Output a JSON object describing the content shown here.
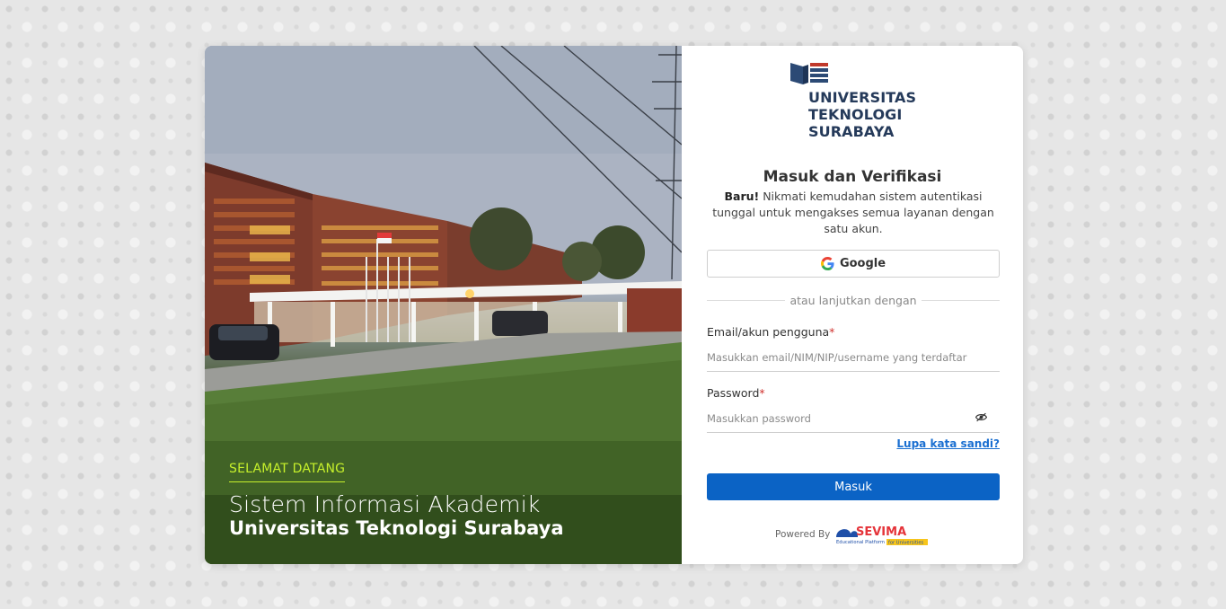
{
  "hero": {
    "welcome": "SELAMAT DATANG",
    "title": "Sistem Informasi Akademik",
    "subtitle": "Universitas Teknologi Surabaya"
  },
  "brand": {
    "line1": "UNIVERSITAS",
    "line2": "TEKNOLOGI",
    "line3": "SURABAYA",
    "color": "#253a5a"
  },
  "login": {
    "heading": "Masuk dan Verifikasi",
    "desc_bold": "Baru!",
    "desc_text": " Nikmati kemudahan sistem autentikasi tunggal untuk mengakses semua layanan dengan satu akun.",
    "google_label": "Google",
    "divider_text": "atau lanjutkan dengan",
    "email_label": "Email/akun pengguna",
    "email_placeholder": "Masukkan email/NIM/NIP/username yang terdaftar",
    "email_value": "",
    "password_label": "Password",
    "password_placeholder": "Masukkan password",
    "password_value": "",
    "required_mark": "*",
    "forgot_label": "Lupa kata sandi?",
    "submit_label": "Masuk",
    "powered_by": "Powered By",
    "accent_color": "#0b63c5"
  },
  "footer_logo": {
    "name": "SEVIMA",
    "tagline": "Educational Platform",
    "tagline_highlight": "for Universities"
  }
}
